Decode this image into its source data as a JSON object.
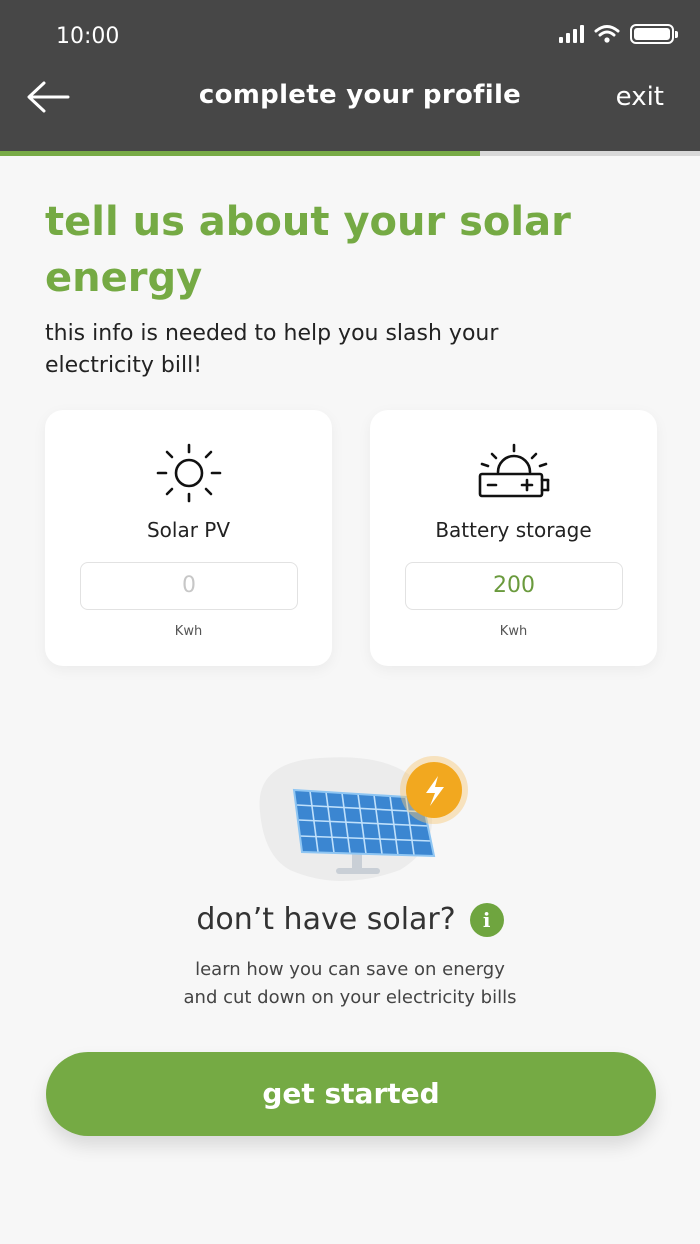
{
  "status_bar": {
    "time": "10:00"
  },
  "header": {
    "title": "complete your profile",
    "exit_label": "exit"
  },
  "progress": {
    "fraction": 0.685
  },
  "heading": "tell us about your solar energy",
  "subtext": "this info is needed to help you slash your electricity bill!",
  "cards": [
    {
      "label": "Solar PV",
      "value": "0",
      "unit": "Kwh",
      "icon": "sun-icon"
    },
    {
      "label": "Battery storage",
      "value": "200",
      "unit": "Kwh",
      "icon": "solar-battery-icon"
    }
  ],
  "no_solar": {
    "title": "don’t have solar?",
    "info_glyph": "i",
    "description": "learn how you can save on energy and cut down on your electricity bills"
  },
  "cta": {
    "label": "get started"
  },
  "colors": {
    "accent": "#75aa44",
    "header_bg": "#474747",
    "panel_blue": "#3f8fd6",
    "badge_orange": "#f2a81f"
  }
}
